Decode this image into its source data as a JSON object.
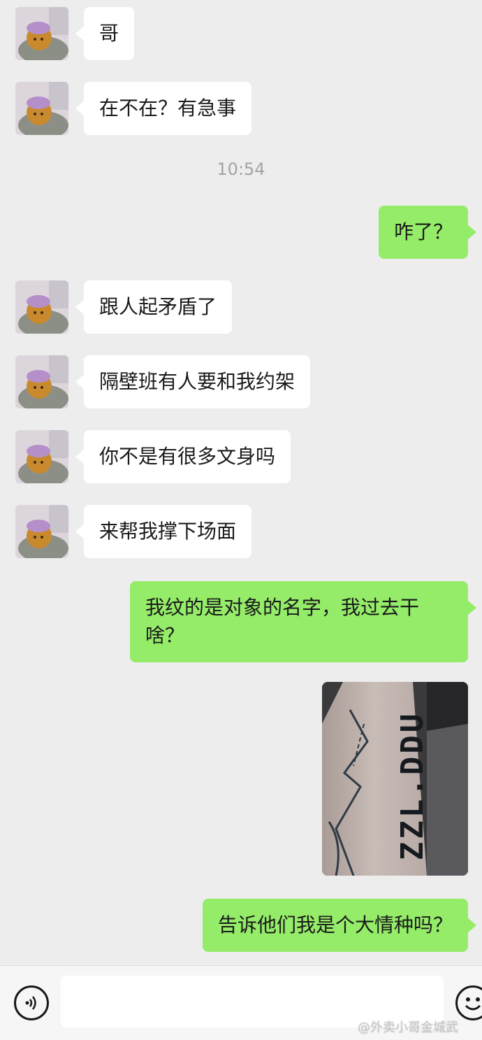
{
  "messages": [
    {
      "side": "in",
      "text": "哥"
    },
    {
      "side": "in",
      "text": "在不在？有急事"
    },
    {
      "side": "out",
      "text": "咋了？"
    },
    {
      "side": "in",
      "text": "跟人起矛盾了"
    },
    {
      "side": "in",
      "text": "隔壁班有人要和我约架"
    },
    {
      "side": "in",
      "text": "你不是有很多文身吗"
    },
    {
      "side": "in",
      "text": "来帮我撑下场面"
    },
    {
      "side": "out",
      "text": "我纹的是对象的名字，我过去干啥？"
    },
    {
      "side": "out",
      "text": "告诉他们我是个大情种吗？"
    }
  ],
  "timestamp": "10:54",
  "photo": {
    "tattoo_text": "ZZL.DDU"
  },
  "watermark": "@外卖小哥金城武",
  "colors": {
    "background": "#ededed",
    "incoming": "#ffffff",
    "outgoing": "#95ec69",
    "timestamp": "#a3a3a3"
  },
  "icons": {
    "voice": "voice-icon",
    "emoji": "emoji-icon",
    "avatar": "avatar-cartoon"
  }
}
